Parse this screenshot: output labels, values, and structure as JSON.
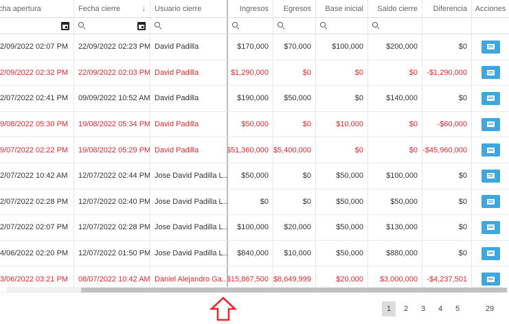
{
  "columns": {
    "fecha_apertura": "cha apertura",
    "fecha_cierre": "Fecha cierre",
    "usuario_cierre": "Usuario cierre",
    "ingresos": "Ingresos",
    "egresos": "Egresos",
    "base_inicial": "Base inicial",
    "saldo_cierre": "Saldo cierre",
    "diferencia": "Diferencia",
    "acciones": "Acciones"
  },
  "sort_indicator": "↓",
  "rows": [
    {
      "apertura": "2/09/2022 02:07 PM",
      "cierre": "22/09/2022 02:23 PM",
      "usuario": "David Padilla",
      "ingresos": "$170,000",
      "egresos": "$70,000",
      "base": "$100,000",
      "saldo": "$200,000",
      "diferencia": "$0",
      "red": false
    },
    {
      "apertura": "2/09/2022 02:32 PM",
      "cierre": "22/09/2022 02:03 PM",
      "usuario": "David Padilla",
      "ingresos": "$1,290,000",
      "egresos": "$0",
      "base": "$0",
      "saldo": "$0",
      "diferencia": "-$1,290,000",
      "red": true
    },
    {
      "apertura": "2/07/2022 02:41 PM",
      "cierre": "09/09/2022 10:52 AM",
      "usuario": "David Padilla",
      "ingresos": "$190,000",
      "egresos": "$50,000",
      "base": "$0",
      "saldo": "$140,000",
      "diferencia": "$0",
      "red": false
    },
    {
      "apertura": "9/08/2022 05:30 PM",
      "cierre": "19/08/2022 05:34 PM",
      "usuario": "David Padilla",
      "ingresos": "$50,000",
      "egresos": "$0",
      "base": "$10,000",
      "saldo": "$0",
      "diferencia": "-$60,000",
      "red": true
    },
    {
      "apertura": "9/07/2022 02:22 PM",
      "cierre": "19/08/2022 05:29 PM",
      "usuario": "David Padilla",
      "ingresos": "$51,360,000",
      "egresos": "$5,400,000",
      "base": "$0",
      "saldo": "$0",
      "diferencia": "-$45,960,000",
      "red": true
    },
    {
      "apertura": "2/07/2022 10:42 AM",
      "cierre": "12/07/2022 02:44 PM",
      "usuario": "Jose David Padilla L...",
      "ingresos": "$50,000",
      "egresos": "$0",
      "base": "$50,000",
      "saldo": "$100,000",
      "diferencia": "$0",
      "red": false
    },
    {
      "apertura": "2/07/2022 02:28 PM",
      "cierre": "12/07/2022 02:40 PM",
      "usuario": "Jose David Padilla L...",
      "ingresos": "$0",
      "egresos": "$0",
      "base": "$50,000",
      "saldo": "$50,000",
      "diferencia": "$0",
      "red": false
    },
    {
      "apertura": "2/07/2022 02:07 PM",
      "cierre": "12/07/2022 02:28 PM",
      "usuario": "Jose David Padilla L...",
      "ingresos": "$100,000",
      "egresos": "$20,000",
      "base": "$50,000",
      "saldo": "$130,000",
      "diferencia": "$0",
      "red": false
    },
    {
      "apertura": "4/06/2022 02:20 PM",
      "cierre": "12/07/2022 01:50 PM",
      "usuario": "Jose David Padilla L...",
      "ingresos": "$840,000",
      "egresos": "$10,000",
      "base": "$50,000",
      "saldo": "$880,000",
      "diferencia": "$0",
      "red": false
    },
    {
      "apertura": "3/06/2022 03:21 PM",
      "cierre": "08/07/2022 10:42 AM",
      "usuario": "Daniel Alejandro Ga...",
      "ingresos": "$15,867,500",
      "egresos": "$8,649,999",
      "base": "$20,000",
      "saldo": "$3,000,000",
      "diferencia": "-$4,237,501",
      "red": true
    }
  ],
  "pagination": {
    "pages": [
      "1",
      "2",
      "3",
      "4",
      "5"
    ],
    "last": "29",
    "active": "1"
  },
  "colors": {
    "accent": "#3fa7de",
    "negative": "#e5282e",
    "annotation": "#e5282e"
  }
}
